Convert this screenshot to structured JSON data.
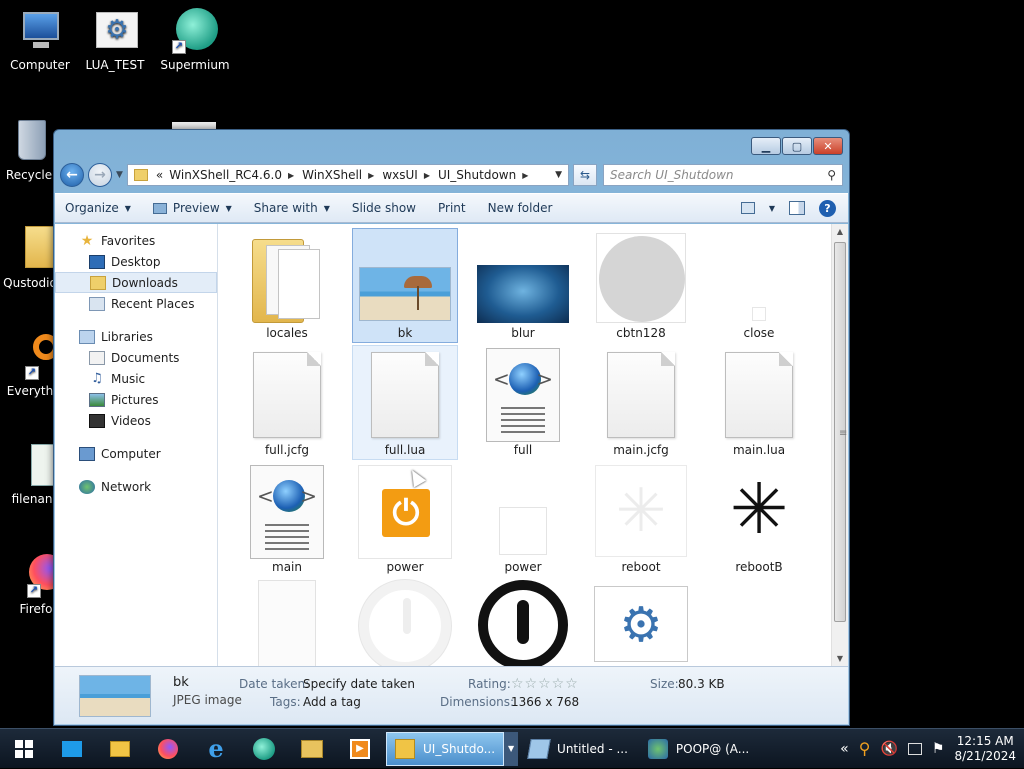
{
  "desktop": {
    "icons": [
      {
        "label": "Computer"
      },
      {
        "label": "LUA_TEST"
      },
      {
        "label": "Supermium"
      },
      {
        "label": "Recycle"
      },
      {
        "label": "Qustodio"
      },
      {
        "label": "Everyth"
      },
      {
        "label": "filenan"
      },
      {
        "label": "Firefo"
      }
    ]
  },
  "window": {
    "address": {
      "overflow": "«",
      "crumbs": [
        "WinXShell_RC4.6.0",
        "WinXShell",
        "wxsUI",
        "UI_Shutdown"
      ]
    },
    "search_placeholder": "Search UI_Shutdown",
    "toolbar": {
      "organize": "Organize",
      "preview": "Preview",
      "share_with": "Share with",
      "slide_show": "Slide show",
      "print": "Print",
      "new_folder": "New folder"
    },
    "nav": {
      "favorites": "Favorites",
      "desktop": "Desktop",
      "downloads": "Downloads",
      "recent_places": "Recent Places",
      "libraries": "Libraries",
      "documents": "Documents",
      "music": "Music",
      "pictures": "Pictures",
      "videos": "Videos",
      "computer": "Computer",
      "network": "Network"
    },
    "files": [
      {
        "name": "locales"
      },
      {
        "name": "bk"
      },
      {
        "name": "blur"
      },
      {
        "name": "cbtn128"
      },
      {
        "name": "close"
      },
      {
        "name": "full.jcfg"
      },
      {
        "name": "full.lua"
      },
      {
        "name": "full"
      },
      {
        "name": "main.jcfg"
      },
      {
        "name": "main.lua"
      },
      {
        "name": "main"
      },
      {
        "name": "power"
      },
      {
        "name": "power"
      },
      {
        "name": "reboot"
      },
      {
        "name": "rebootB"
      },
      {
        "name": ""
      },
      {
        "name": ""
      },
      {
        "name": ""
      },
      {
        "name": ""
      }
    ],
    "details": {
      "name": "bk",
      "type": "JPEG image",
      "date_taken_label": "Date taken:",
      "date_taken_value": "Specify date taken",
      "tags_label": "Tags:",
      "tags_value": "Add a tag",
      "rating_label": "Rating:",
      "rating_stars": "☆☆☆☆☆",
      "dimensions_label": "Dimensions:",
      "dimensions_value": "1366 x 768",
      "size_label": "Size:",
      "size_value": "80.3 KB"
    }
  },
  "taskbar": {
    "tasks": [
      {
        "label": "UI_Shutdo..."
      },
      {
        "label": "Untitled - ..."
      },
      {
        "label": "POOP@ (A..."
      }
    ],
    "time": "12:15 AM",
    "date": "8/21/2024"
  }
}
